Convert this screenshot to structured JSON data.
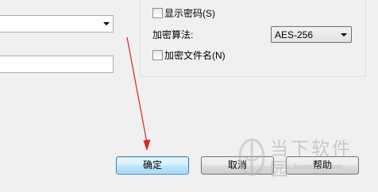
{
  "options": {
    "show_password_label": "显示密码(S)",
    "algorithm_label": "加密算法:",
    "algorithm_value": "AES-256",
    "encrypt_filename_label": "加密文件名(N)"
  },
  "buttons": {
    "ok_label": "确定",
    "cancel_label": "取消",
    "help_label": "帮助"
  },
  "watermark": {
    "title": "当下软件园",
    "url": "www.downxia.com"
  },
  "colors": {
    "annotation_arrow": "#e02020",
    "default_button_border": "#3c7fb1"
  }
}
